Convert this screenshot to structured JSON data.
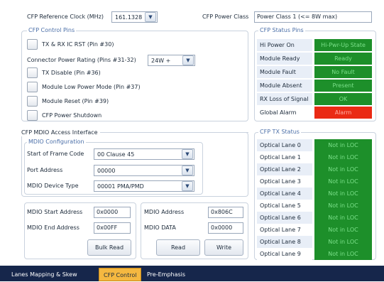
{
  "ref_clock": {
    "label": "CFP Reference Clock (MHz)",
    "value": "161.1328"
  },
  "power_class": {
    "label": "CFP Power Class",
    "value": "Power Class 1 (<= 8W max)"
  },
  "control_pins": {
    "title": "CFP Control Pins",
    "tx_rx_rst": "TX & RX IC RST (Pin #30)",
    "connector_power_label": "Connector Power Rating (Pins #31-32)",
    "connector_power_value": "24W +",
    "tx_disable": "TX Disable (Pin #36)",
    "low_power": "Module Low Power Mode (Pin #37)",
    "module_reset": "Module Reset (Pin #39)",
    "power_shutdown": "CFP Power Shutdown"
  },
  "status_pins": {
    "title": "CFP Status Pins",
    "rows": [
      {
        "name": "Hi Power On",
        "status": "Hi-Pwr-Up State"
      },
      {
        "name": "Module Ready",
        "status": "Ready"
      },
      {
        "name": "Module Fault",
        "status": "No Fault"
      },
      {
        "name": "Module Absent",
        "status": "Present"
      },
      {
        "name": "RX Loss of Signal",
        "status": "OK"
      },
      {
        "name": "Global Alarm",
        "status": "Alarm"
      }
    ]
  },
  "mdio": {
    "title": "CFP MDIO Access Interface",
    "config_title": "MDIO Configuration",
    "sof_label": "Start of Frame Code",
    "sof_value": "00 Clause 45",
    "port_label": "Port Address",
    "port_value": "00000",
    "device_label": "MDIO Device Type",
    "device_value": "00001 PMA/PMD",
    "start_addr_label": "MDIO Start Address",
    "start_addr_value": "0x0000",
    "end_addr_label": "MDIO End Address",
    "end_addr_value": "0x00FF",
    "bulk_read": "Bulk Read",
    "address_label": "MDIO Address",
    "address_value": "0x806C",
    "data_label": "MDIO DATA",
    "data_value": "0x0000",
    "read": "Read",
    "write": "Write"
  },
  "tx_status": {
    "title": "CFP TX Status",
    "lanes": [
      {
        "name": "Optical Lane 0",
        "status": "Not in LOC"
      },
      {
        "name": "Optical Lane 1",
        "status": "Not in LOC"
      },
      {
        "name": "Optical Lane 2",
        "status": "Not in LOC"
      },
      {
        "name": "Optical Lane 3",
        "status": "Not in LOC"
      },
      {
        "name": "Optical Lane 4",
        "status": "Not in LOC"
      },
      {
        "name": "Optical Lane 5",
        "status": "Not in LOC"
      },
      {
        "name": "Optical Lane 6",
        "status": "Not in LOC"
      },
      {
        "name": "Optical Lane 7",
        "status": "Not in LOC"
      },
      {
        "name": "Optical Lane 8",
        "status": "Not in LOC"
      },
      {
        "name": "Optical Lane 9",
        "status": "Not in LOC"
      }
    ]
  },
  "tabs": [
    "Lanes Mapping & Skew",
    "CFP Control",
    "Pre-Emphasis"
  ],
  "colors": {
    "ok_green": "#1d8f2a",
    "alarm_red": "#ea2a14",
    "active_tab": "#f5b840",
    "tab_bar": "#16264b"
  }
}
